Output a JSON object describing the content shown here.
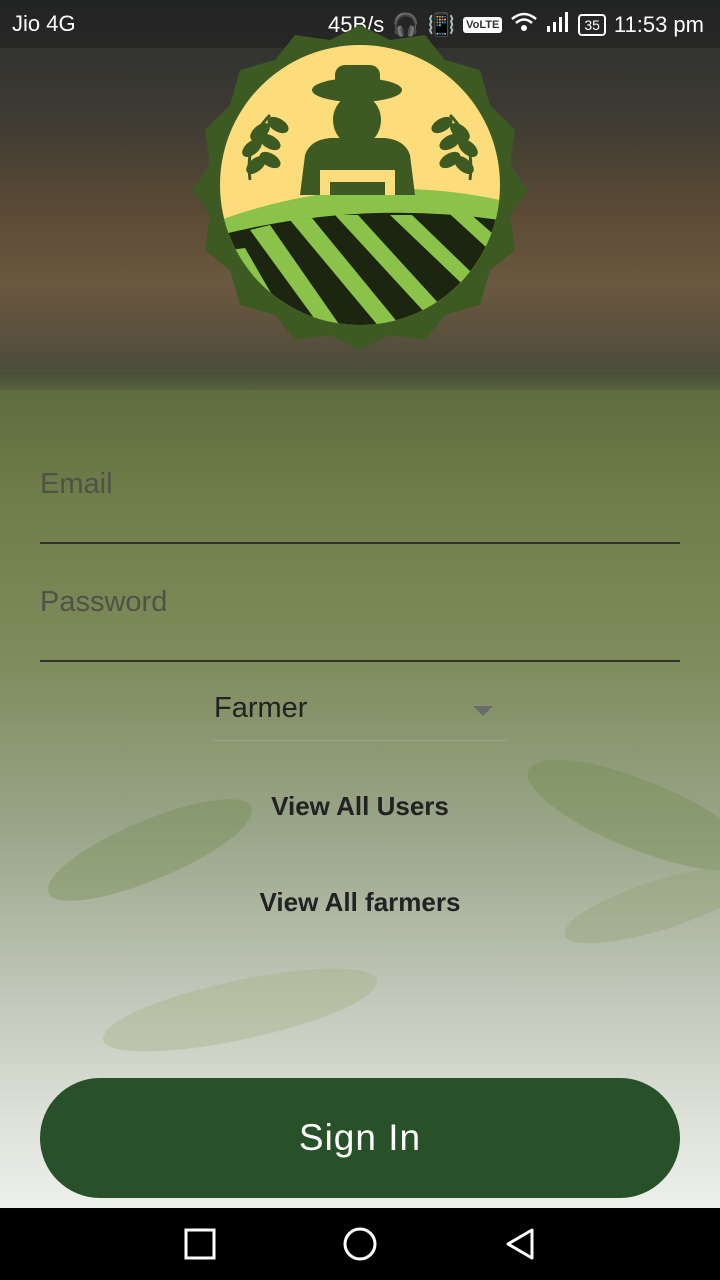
{
  "status_bar": {
    "carrier": "Jio 4G",
    "speed": "45B/s",
    "volte": "VoLTE",
    "battery": "35",
    "time": "11:53 pm"
  },
  "form": {
    "email_placeholder": "Email",
    "password_placeholder": "Password",
    "role_selected": "Farmer"
  },
  "links": {
    "view_all_users": "View All Users",
    "view_all_farmers": "View All farmers"
  },
  "buttons": {
    "sign_in": "Sign In"
  },
  "nav_bar": {
    "icons": [
      "recent-apps-icon",
      "home-icon",
      "back-icon"
    ]
  },
  "colors": {
    "primary": "#295129",
    "logo_bg": "#3e5a23",
    "logo_inner": "#fddc7c",
    "field_green": "#8bc34a"
  }
}
